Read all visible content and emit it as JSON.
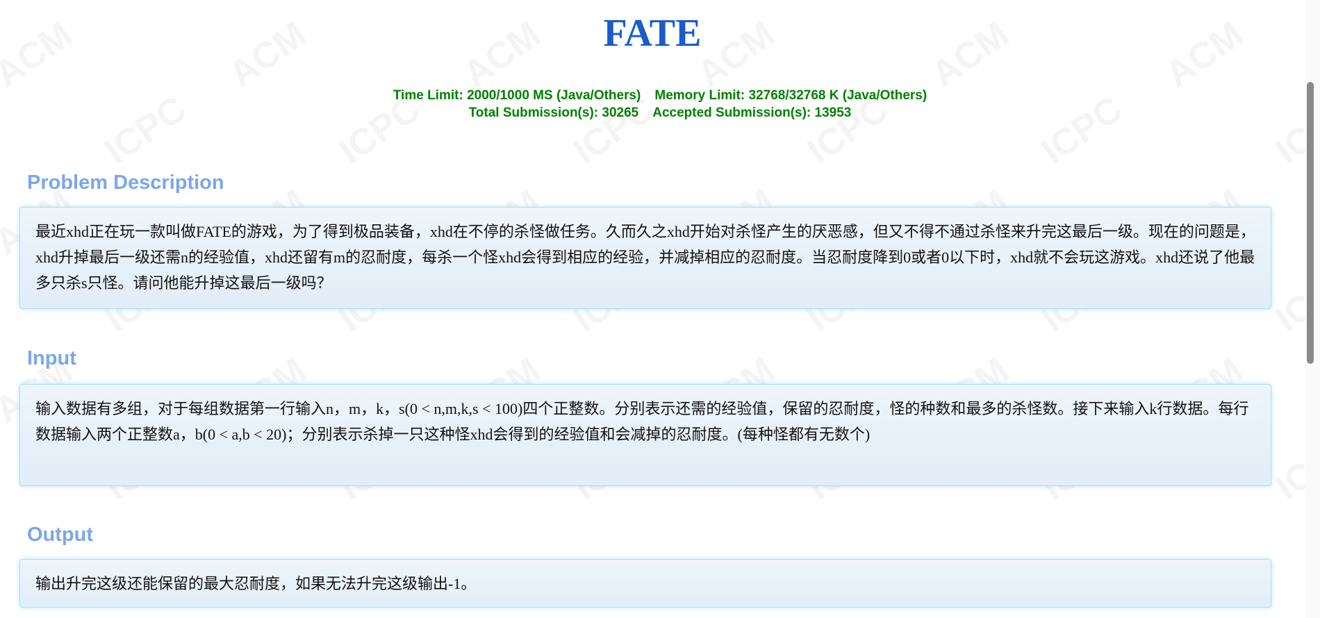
{
  "title": "FATE",
  "limits": {
    "time_limit": "Time Limit: 2000/1000 MS (Java/Others)",
    "memory_limit": "Memory Limit: 32768/32768 K (Java/Others)",
    "total_submissions": "Total Submission(s): 30265",
    "accepted_submissions": "Accepted Submission(s): 13953"
  },
  "watermark": "ACM ICPC",
  "sections": [
    {
      "header": "Problem Description",
      "text": "最近xhd正在玩一款叫做FATE的游戏，为了得到极品装备，xhd在不停的杀怪做任务。久而久之xhd开始对杀怪产生的厌恶感，但又不得不通过杀怪来升完这最后一级。现在的问题是，xhd升掉最后一级还需n的经验值，xhd还留有m的忍耐度，每杀一个怪xhd会得到相应的经验，并减掉相应的忍耐度。当忍耐度降到0或者0以下时，xhd就不会玩这游戏。xhd还说了他最多只杀s只怪。请问他能升掉这最后一级吗？"
    },
    {
      "header": "Input",
      "text": "输入数据有多组，对于每组数据第一行输入n，m，k，s(0 < n,m,k,s < 100)四个正整数。分别表示还需的经验值，保留的忍耐度，怪的种数和最多的杀怪数。接下来输入k行数据。每行数据输入两个正整数a，b(0 < a,b < 20)；分别表示杀掉一只这种怪xhd会得到的经验值和会减掉的忍耐度。(每种怪都有无数个)"
    },
    {
      "header": "Output",
      "text": "输出升完这级还能保留的最大忍耐度，如果无法升完这级输出-1。"
    }
  ],
  "colors": {
    "title": "#1a5cc8",
    "limits": "#008000",
    "header": "#7ca7e8",
    "box_border": "#a8e2f4"
  }
}
